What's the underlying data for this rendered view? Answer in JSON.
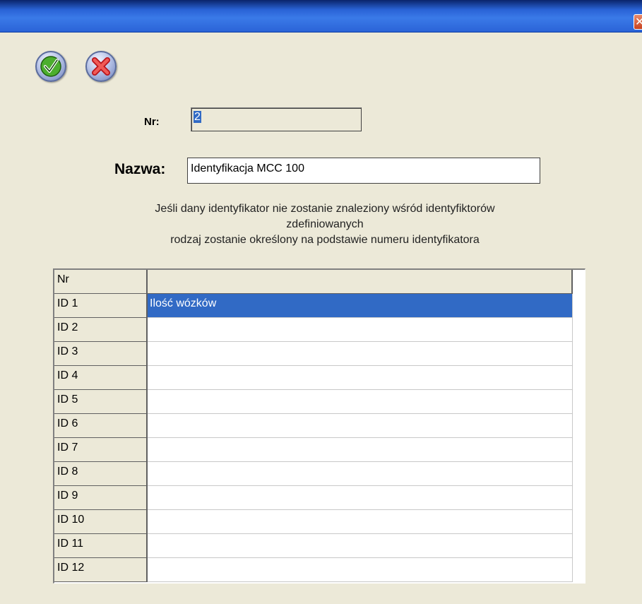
{
  "window": {
    "close_icon": "close-icon"
  },
  "toolbar": {
    "ok_icon": "checkmark-icon",
    "cancel_icon": "cancel-x-icon"
  },
  "form": {
    "nr_label": "Nr:",
    "nr_value": "2",
    "nazwa_label": "Nazwa:",
    "nazwa_value": "Identyfikacja MCC 100",
    "info_line1": "Jeśli dany identyfikator nie zostanie znaleziony wśród identyfiktorów",
    "info_line2": "zdefiniowanych",
    "info_line3": "rodzaj zostanie określony na podstawie numeru identyfikatora"
  },
  "grid": {
    "header_nr": "Nr",
    "header_value": "",
    "rows": [
      {
        "nr": "ID 1",
        "value": "Ilość wózków",
        "selected": true
      },
      {
        "nr": "ID 2",
        "value": ""
      },
      {
        "nr": "ID 3",
        "value": ""
      },
      {
        "nr": "ID 4",
        "value": ""
      },
      {
        "nr": "ID 5",
        "value": ""
      },
      {
        "nr": "ID 6",
        "value": ""
      },
      {
        "nr": "ID 7",
        "value": ""
      },
      {
        "nr": "ID 8",
        "value": ""
      },
      {
        "nr": "ID 9",
        "value": ""
      },
      {
        "nr": "ID 10",
        "value": ""
      },
      {
        "nr": "ID 11",
        "value": ""
      },
      {
        "nr": "ID 12",
        "value": ""
      }
    ]
  },
  "colors": {
    "window_bg": "#ece9d8",
    "title_bar": "#2a63d6",
    "selection": "#316ac5"
  }
}
